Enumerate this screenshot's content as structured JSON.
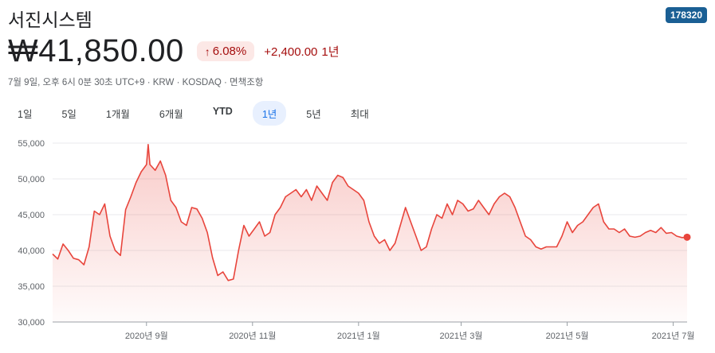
{
  "stock": {
    "name": "서진시스템",
    "ticker": "178320",
    "price": "₩41,850.00",
    "change_percent": "6.08%",
    "change_value": "+2,400.00",
    "change_period": "1년",
    "meta": "7월 9일, 오후 6시 0분 30초 UTC+9 · KRW · KOSDAQ · 면책조항"
  },
  "colors": {
    "line": "#e8453c",
    "badge_bg": "#fce8e6",
    "badge_text": "#a50e0e",
    "tab_active": "#1a73e8"
  },
  "tabs": [
    {
      "label": "1일",
      "active": false
    },
    {
      "label": "5일",
      "active": false
    },
    {
      "label": "1개월",
      "active": false
    },
    {
      "label": "6개월",
      "active": false
    },
    {
      "label": "YTD",
      "active": false
    },
    {
      "label": "1년",
      "active": true
    },
    {
      "label": "5년",
      "active": false
    },
    {
      "label": "최대",
      "active": false
    }
  ],
  "chart_data": {
    "type": "area",
    "title": "",
    "xlabel": "",
    "ylabel": "",
    "ylim": [
      30000,
      55000
    ],
    "yticks": [
      55000,
      50000,
      45000,
      40000,
      35000,
      30000
    ],
    "ytick_labels": [
      "55,000",
      "50,000",
      "45,000",
      "40,000",
      "35,000",
      "30,000"
    ],
    "xlim": [
      "2020-07-09",
      "2021-07-09"
    ],
    "xticks": [
      "2020-09-01",
      "2020-11-01",
      "2021-01-01",
      "2021-03-01",
      "2021-05-01",
      "2021-07-01"
    ],
    "xtick_labels": [
      "2020년 9월",
      "2020년 11월",
      "2021년 1월",
      "2021년 3월",
      "2021년 5월",
      "2021년 7월"
    ],
    "grid": "horizontal",
    "series": [
      {
        "x": [
          "2020-07-09",
          "2020-07-12",
          "2020-07-15",
          "2020-07-18",
          "2020-07-21",
          "2020-07-24",
          "2020-07-27",
          "2020-07-30",
          "2020-08-02",
          "2020-08-05",
          "2020-08-08",
          "2020-08-11",
          "2020-08-14",
          "2020-08-17",
          "2020-08-20",
          "2020-08-23",
          "2020-08-26",
          "2020-08-29",
          "2020-09-01",
          "2020-09-02",
          "2020-09-03",
          "2020-09-06",
          "2020-09-09",
          "2020-09-12",
          "2020-09-15",
          "2020-09-18",
          "2020-09-21",
          "2020-09-24",
          "2020-09-27",
          "2020-09-30",
          "2020-10-03",
          "2020-10-06",
          "2020-10-09",
          "2020-10-12",
          "2020-10-15",
          "2020-10-18",
          "2020-10-21",
          "2020-10-24",
          "2020-10-27",
          "2020-10-30",
          "2020-11-02",
          "2020-11-05",
          "2020-11-08",
          "2020-11-11",
          "2020-11-14",
          "2020-11-17",
          "2020-11-20",
          "2020-11-23",
          "2020-11-26",
          "2020-11-29",
          "2020-12-02",
          "2020-12-05",
          "2020-12-08",
          "2020-12-11",
          "2020-12-14",
          "2020-12-17",
          "2020-12-20",
          "2020-12-23",
          "2020-12-26",
          "2020-12-29",
          "2021-01-01",
          "2021-01-04",
          "2021-01-07",
          "2021-01-10",
          "2021-01-13",
          "2021-01-16",
          "2021-01-19",
          "2021-01-22",
          "2021-01-25",
          "2021-01-28",
          "2021-01-31",
          "2021-02-03",
          "2021-02-06",
          "2021-02-09",
          "2021-02-12",
          "2021-02-15",
          "2021-02-18",
          "2021-02-21",
          "2021-02-24",
          "2021-02-27",
          "2021-03-02",
          "2021-03-05",
          "2021-03-08",
          "2021-03-11",
          "2021-03-14",
          "2021-03-17",
          "2021-03-20",
          "2021-03-23",
          "2021-03-26",
          "2021-03-29",
          "2021-04-01",
          "2021-04-04",
          "2021-04-07",
          "2021-04-10",
          "2021-04-13",
          "2021-04-16",
          "2021-04-19",
          "2021-04-22",
          "2021-04-25",
          "2021-04-28",
          "2021-05-01",
          "2021-05-04",
          "2021-05-07",
          "2021-05-10",
          "2021-05-13",
          "2021-05-16",
          "2021-05-19",
          "2021-05-22",
          "2021-05-25",
          "2021-05-28",
          "2021-05-31",
          "2021-06-03",
          "2021-06-06",
          "2021-06-09",
          "2021-06-12",
          "2021-06-15",
          "2021-06-18",
          "2021-06-21",
          "2021-06-24",
          "2021-06-27",
          "2021-06-30",
          "2021-07-03",
          "2021-07-06",
          "2021-07-09"
        ],
        "values": [
          39500,
          38800,
          40900,
          40000,
          38900,
          38700,
          38000,
          40500,
          45500,
          45000,
          46500,
          42000,
          40000,
          39300,
          45700,
          47500,
          49500,
          51000,
          52000,
          54800,
          52000,
          51200,
          52500,
          50500,
          47000,
          46000,
          44000,
          43500,
          46000,
          45800,
          44500,
          42500,
          39000,
          36500,
          37000,
          35800,
          36000,
          40000,
          43500,
          42000,
          43000,
          44000,
          42000,
          42500,
          45000,
          46000,
          47500,
          48000,
          48500,
          47500,
          48500,
          47000,
          49000,
          48000,
          47000,
          49500,
          50500,
          50200,
          49000,
          48500,
          48000,
          47000,
          44000,
          42000,
          41000,
          41500,
          40000,
          41000,
          43500,
          46000,
          44000,
          42000,
          40000,
          40500,
          43000,
          45000,
          44500,
          46500,
          45000,
          47000,
          46500,
          45500,
          45800,
          47000,
          46000,
          45000,
          46500,
          47500,
          48000,
          47500,
          46000,
          44000,
          42000,
          41500,
          40500,
          40200,
          40500,
          40500,
          40500,
          42000,
          44000,
          42500,
          43500,
          44000,
          45000,
          46000,
          46500,
          44000,
          43000,
          43000,
          42500,
          43000,
          42000,
          41850,
          42000,
          42500,
          42800,
          42500,
          43200,
          42400,
          42500,
          42000,
          41800,
          41850
        ]
      }
    ]
  }
}
